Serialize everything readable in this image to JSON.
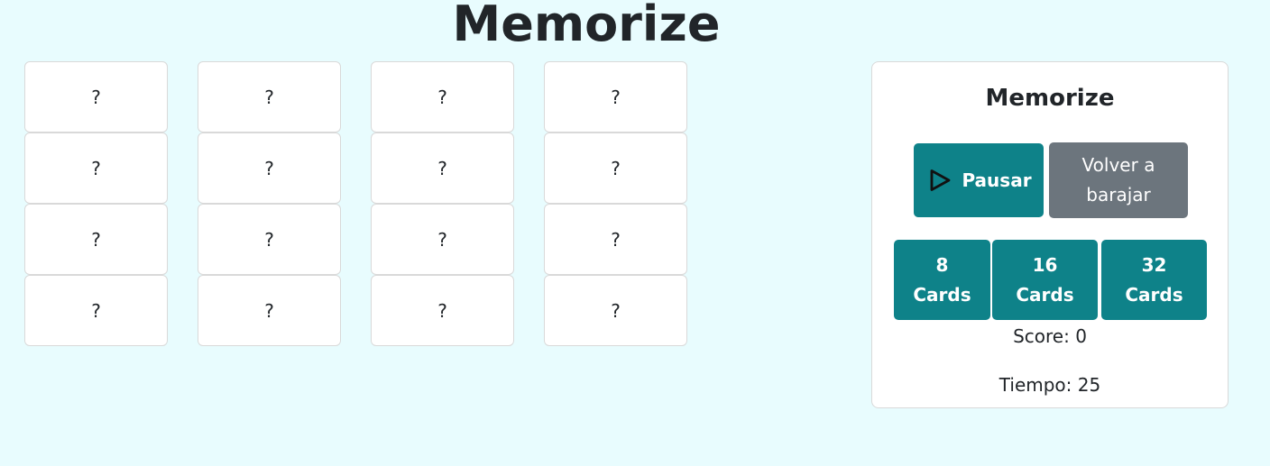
{
  "header": {
    "title": "Memorize"
  },
  "grid": {
    "cards": [
      {
        "label": "?"
      },
      {
        "label": "?"
      },
      {
        "label": "?"
      },
      {
        "label": "?"
      },
      {
        "label": "?"
      },
      {
        "label": "?"
      },
      {
        "label": "?"
      },
      {
        "label": "?"
      },
      {
        "label": "?"
      },
      {
        "label": "?"
      },
      {
        "label": "?"
      },
      {
        "label": "?"
      },
      {
        "label": "?"
      },
      {
        "label": "?"
      },
      {
        "label": "?"
      },
      {
        "label": "?"
      }
    ]
  },
  "panel": {
    "title": "Memorize",
    "pause_label": "Pausar",
    "pause_icon": "play-icon",
    "shuffle_label": "Volver a barajar",
    "decks": [
      {
        "count": "8",
        "unit": "Cards"
      },
      {
        "count": "16",
        "unit": "Cards"
      },
      {
        "count": "32",
        "unit": "Cards"
      }
    ],
    "score_label": "Score: 0",
    "time_label": "Tiempo: 25"
  },
  "colors": {
    "background": "#e8fcfe",
    "teal": "#0e8289",
    "gray": "#6c757d",
    "card": "#ffffff",
    "text": "#212529"
  }
}
